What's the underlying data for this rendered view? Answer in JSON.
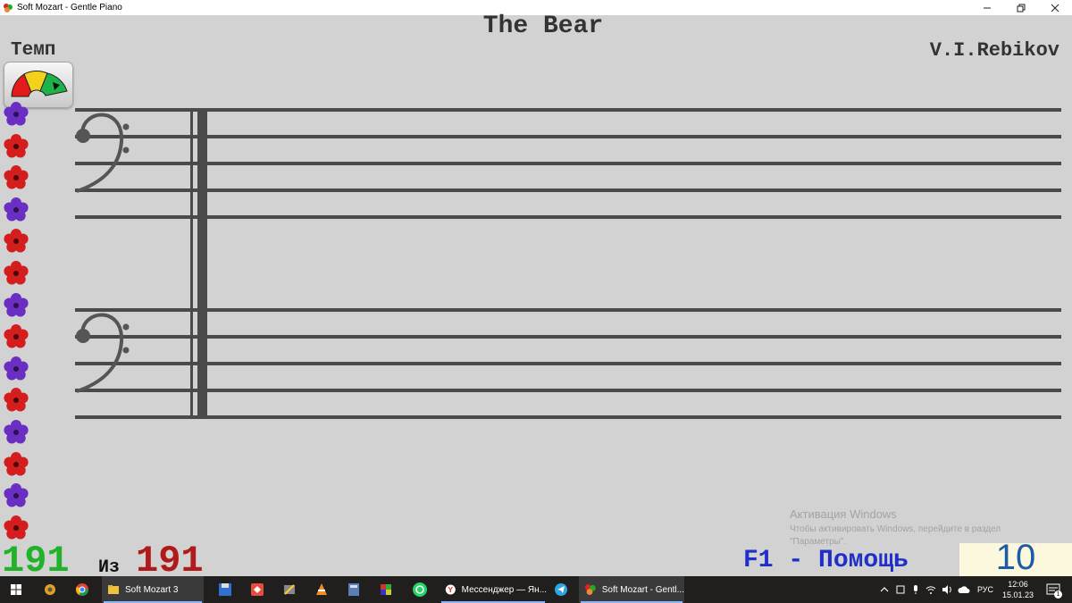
{
  "window": {
    "title": "Soft Mozart - Gentle Piano",
    "controls": [
      "minimize",
      "restore",
      "close"
    ]
  },
  "score": {
    "title": "The Bear",
    "composer": "V.I.Rebikov",
    "staves": [
      "bass-clef",
      "bass-clef"
    ]
  },
  "tempo": {
    "label": "Темп",
    "gauge_segments": [
      "#e41b1b",
      "#f2d21b",
      "#1fb24b"
    ]
  },
  "flowers": {
    "colors": [
      "red",
      "purple"
    ],
    "pattern": [
      "purple",
      "red",
      "red",
      "purple",
      "red",
      "red",
      "purple",
      "red",
      "purple",
      "red",
      "purple",
      "red",
      "purple",
      "red"
    ]
  },
  "progress": {
    "current": "191",
    "separator": "Из",
    "total": "191"
  },
  "help_hint": "F1 - Помощь",
  "score_counter": "10",
  "activation": {
    "line1": "Активация Windows",
    "line2": "Чтобы активировать Windows, перейдите в раздел",
    "line3": "\"Параметры\"."
  },
  "taskbar": {
    "tasks": [
      {
        "label": "Soft Mozart 3",
        "icon": "folder-icon"
      },
      {
        "label": "Мессенджер — Ян...",
        "icon": "yandex-icon"
      },
      {
        "label": "Soft Mozart - Gentl...",
        "icon": "soft-mozart-icon"
      }
    ],
    "language": "РУС",
    "time": "12:06",
    "date": "15.01.23",
    "notification_count": "1"
  },
  "colors": {
    "background": "#d2d2d2",
    "staff_lines": "#4a4a4a",
    "current_count": "#20b228",
    "total_count": "#b01a1a",
    "help_text": "#1f2fc8",
    "score_box": "#fbf8dd"
  }
}
